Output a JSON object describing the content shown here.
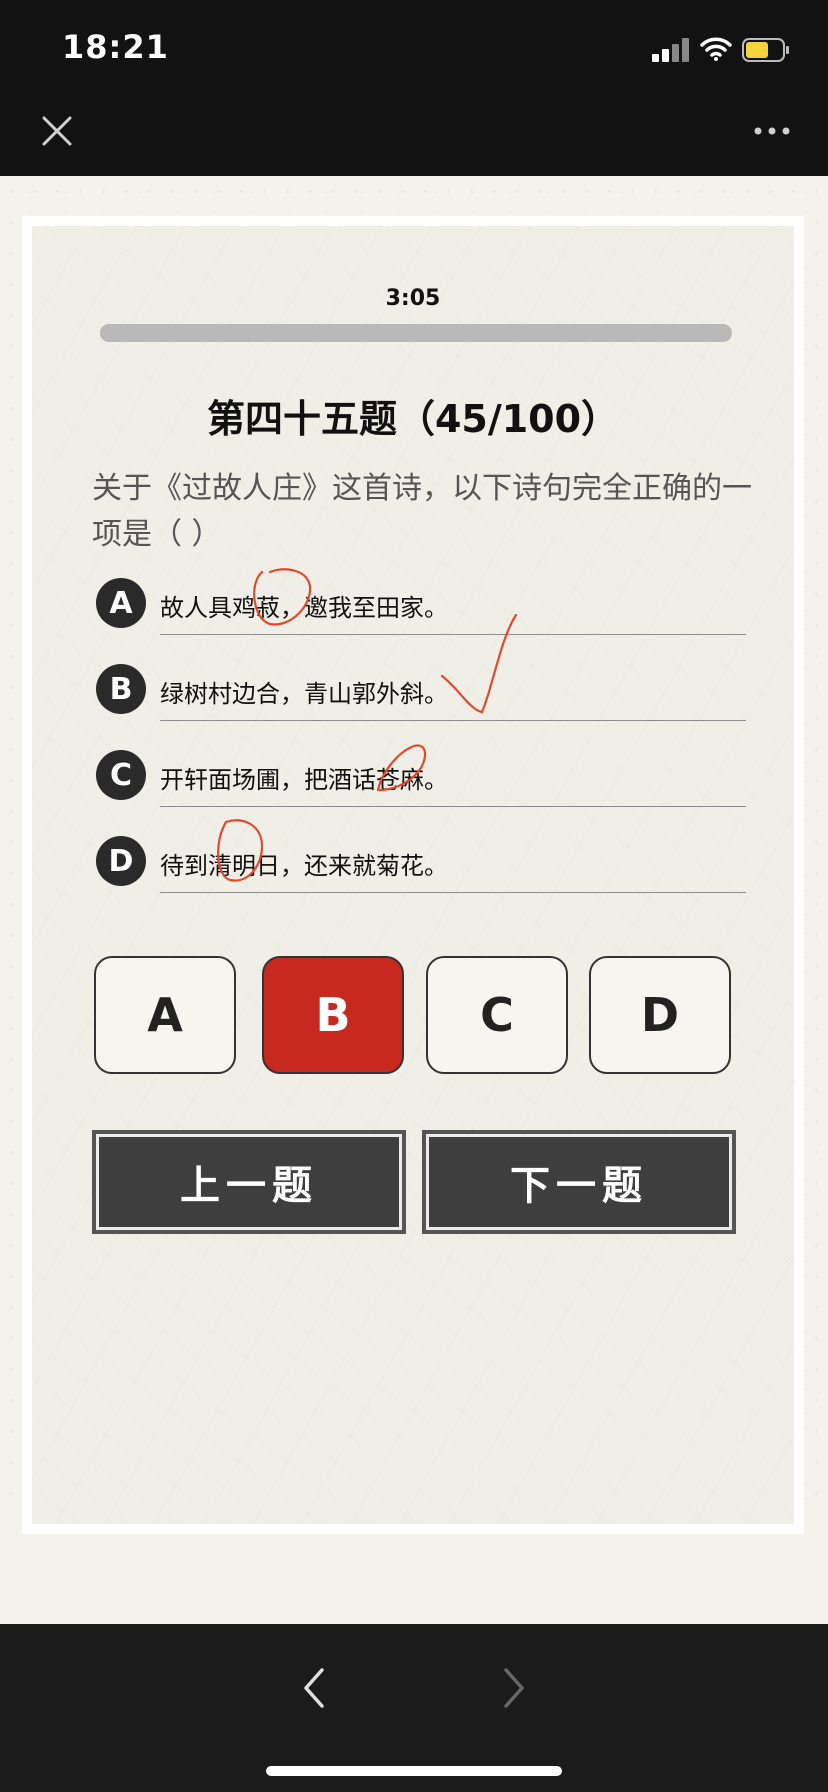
{
  "status_bar": {
    "time": "18:21"
  },
  "timer": "3:05",
  "progress": 0.45,
  "question": {
    "title": "第四十五题（45/100）",
    "text": "关于《过故人庄》这首诗，以下诗句完全正确的一项是（ ）"
  },
  "options": [
    {
      "letter": "A",
      "text": "故人具鸡菽，邀我至田家。"
    },
    {
      "letter": "B",
      "text": "绿树村边合，青山郭外斜。"
    },
    {
      "letter": "C",
      "text": "开轩面场圃，把酒话苍麻。"
    },
    {
      "letter": "D",
      "text": "待到清明日，还来就菊花。"
    }
  ],
  "choices": [
    "A",
    "B",
    "C",
    "D"
  ],
  "selected_choice": "B",
  "buttons": {
    "prev": "上一题",
    "next": "下一题"
  },
  "colors": {
    "selected": "#c8291f",
    "annotation": "#e04a2a",
    "badge": "#2a2a2a"
  }
}
